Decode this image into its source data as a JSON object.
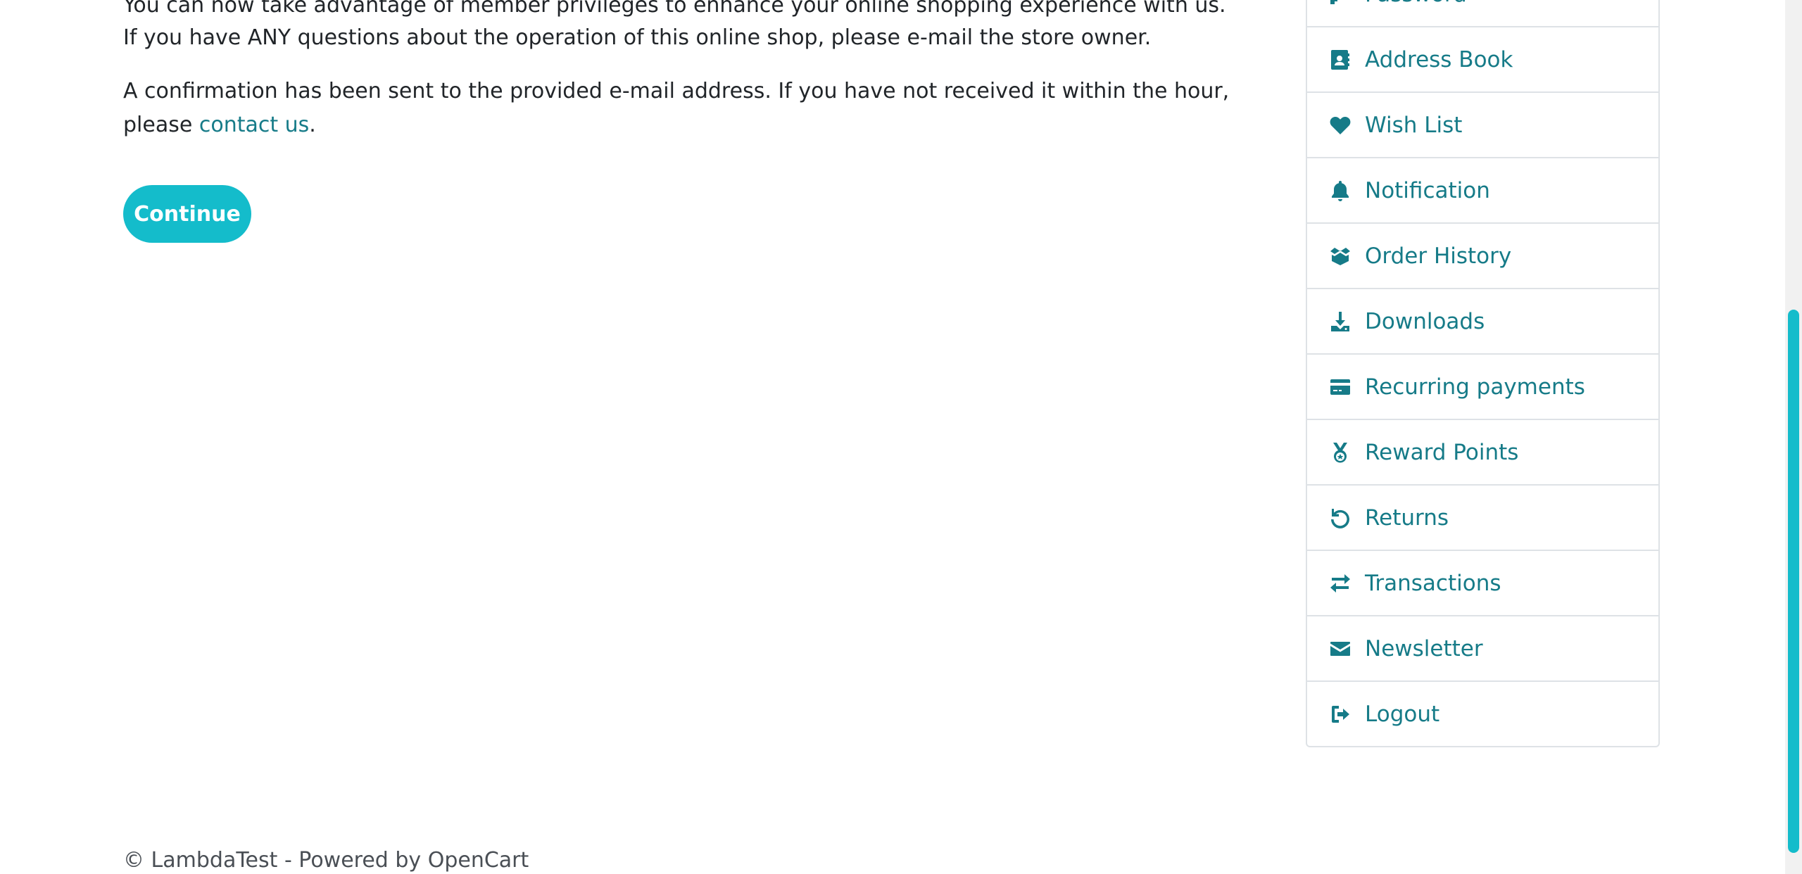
{
  "main": {
    "paragraph1": "You can now take advantage of member privileges to enhance your online shopping experience with us.",
    "paragraph2": "If you have ANY questions about the operation of this online shop, please e-mail the store owner.",
    "paragraph3_text": "A confirmation has been sent to the provided e-mail address. If you have not received it within the hour, please ",
    "paragraph3_link": "contact us",
    "paragraph3_end": ".",
    "continue_label": "Continue"
  },
  "sidebar": {
    "items": [
      {
        "label": "Password",
        "icon": "key-icon"
      },
      {
        "label": "Address Book",
        "icon": "address-book-icon"
      },
      {
        "label": "Wish List",
        "icon": "heart-icon"
      },
      {
        "label": "Notification",
        "icon": "bell-icon"
      },
      {
        "label": "Order History",
        "icon": "box-open-icon"
      },
      {
        "label": "Downloads",
        "icon": "download-icon"
      },
      {
        "label": "Recurring payments",
        "icon": "credit-card-icon"
      },
      {
        "label": "Reward Points",
        "icon": "medal-icon"
      },
      {
        "label": "Returns",
        "icon": "undo-icon"
      },
      {
        "label": "Transactions",
        "icon": "exchange-icon"
      },
      {
        "label": "Newsletter",
        "icon": "envelope-icon"
      },
      {
        "label": "Logout",
        "icon": "sign-out-icon"
      }
    ]
  },
  "footer": {
    "text": "© LambdaTest - Powered by OpenCart"
  },
  "colors": {
    "accent": "#167b88",
    "button": "#14bccb",
    "text": "#212529",
    "border": "#dee2e6"
  }
}
